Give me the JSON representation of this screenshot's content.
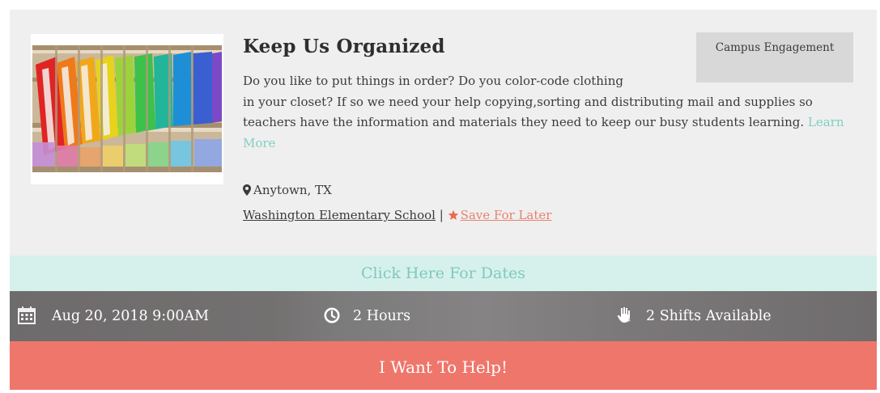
{
  "opportunity": {
    "title": "Keep Us Organized",
    "category": "Campus Engagement",
    "description_line1": "Do you like to put things in order? Do you color-code clothing",
    "description_rest": "in your closet? If so we need your help copying,sorting and distributing mail and supplies so teachers have the information and materials they need to keep our busy students learning.",
    "learn_more": "Learn More",
    "location": "Anytown, TX",
    "school": "Washington Elementary School",
    "separator": "|",
    "save_label": "Save For Later",
    "image_icon": "mailbox-sorter-photo"
  },
  "dates_bar": {
    "label": "Click Here For Dates"
  },
  "info": {
    "date": "Aug 20, 2018  9:00AM",
    "duration": "2 Hours",
    "shifts": "2 Shifts Available",
    "date_icon": "calendar-icon",
    "duration_icon": "clock-icon",
    "shifts_icon": "hand-icon"
  },
  "action": {
    "help_label": "I Want To Help!"
  },
  "colors": {
    "accent_teal": "#7fd0c0",
    "dates_bar_bg": "#d6f1ec",
    "action_red": "#ef766b",
    "save_orange": "#e8826f",
    "info_bar_bg": "#737070"
  }
}
